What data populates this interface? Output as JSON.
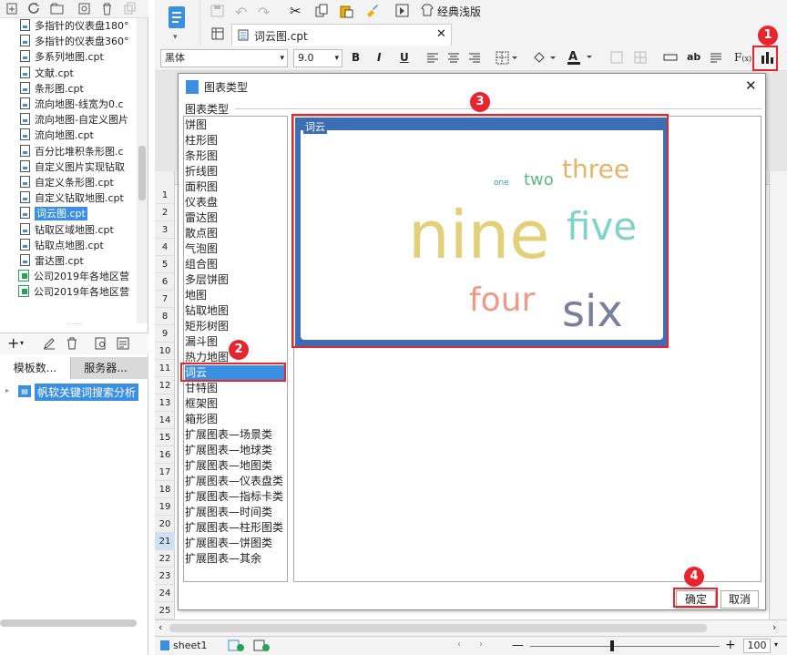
{
  "left_panel": {
    "tree_items": [
      {
        "label": "多指针的仪表盘180°",
        "type": "cpt"
      },
      {
        "label": "多指针的仪表盘360°",
        "type": "cpt"
      },
      {
        "label": "多系列地图.cpt",
        "type": "cpt"
      },
      {
        "label": "文献.cpt",
        "type": "cpt"
      },
      {
        "label": "条形图.cpt",
        "type": "cpt"
      },
      {
        "label": "流向地图-线宽为0.c",
        "type": "cpt"
      },
      {
        "label": "流向地图-自定义图片",
        "type": "cpt"
      },
      {
        "label": "流向地图.cpt",
        "type": "cpt"
      },
      {
        "label": "百分比堆积条形图.c",
        "type": "cpt"
      },
      {
        "label": "自定义图片实现钻取",
        "type": "cpt"
      },
      {
        "label": "自定义条形图.cpt",
        "type": "cpt"
      },
      {
        "label": "自定义钻取地图.cpt",
        "type": "cpt"
      },
      {
        "label": "词云图.cpt",
        "type": "cpt",
        "selected": true
      },
      {
        "label": "钻取区域地图.cpt",
        "type": "cpt"
      },
      {
        "label": "钻取点地图.cpt",
        "type": "cpt"
      },
      {
        "label": "雷达图.cpt",
        "type": "cpt"
      },
      {
        "label": "公司2019年各地区营",
        "type": "sheet"
      },
      {
        "label": "公司2019年各地区营",
        "type": "sheet"
      }
    ],
    "tabs": [
      "模板数...",
      "服务器..."
    ],
    "project_item": "帆软关键词搜索分析"
  },
  "toolbar": {
    "classic_style": "经典浅版",
    "file_tab": "词云图.cpt"
  },
  "format_bar": {
    "font": "黑体",
    "size": "9.0"
  },
  "row_numbers": [
    "1",
    "2",
    "3",
    "4",
    "5",
    "6",
    "7",
    "8",
    "9",
    "10",
    "11",
    "12",
    "13",
    "14",
    "15",
    "16",
    "17",
    "18",
    "19",
    "20",
    "21",
    "22",
    "23",
    "24",
    "25"
  ],
  "bottom": {
    "sheet_tab": "sheet1",
    "zoom": "100"
  },
  "dialog": {
    "title": "图表类型",
    "section_label": "图表类型",
    "types": [
      "饼图",
      "柱形图",
      "条形图",
      "折线图",
      "面积图",
      "仪表盘",
      "雷达图",
      "散点图",
      "气泡图",
      "组合图",
      "多层饼图",
      "地图",
      "钻取地图",
      "矩形树图",
      "漏斗图",
      "热力地图",
      "词云",
      "甘特图",
      "框架图",
      "箱形图",
      "扩展图表—场景类",
      "扩展图表—地球类",
      "扩展图表—地图类",
      "扩展图表—仪表盘类",
      "扩展图表—指标卡类",
      "扩展图表—时间类",
      "扩展图表—柱形图类",
      "扩展图表—饼图类",
      "扩展图表—其余"
    ],
    "selected_type": "词云",
    "preview_title": "词云",
    "words": [
      {
        "text": "one",
        "color": "#3a8fd0"
      },
      {
        "text": "two",
        "color": "#5fb88a"
      },
      {
        "text": "three",
        "color": "#e8b36a"
      },
      {
        "text": "nine",
        "color": "#e2d07a"
      },
      {
        "text": "five",
        "color": "#7fd3c8"
      },
      {
        "text": "four",
        "color": "#ef9a86"
      },
      {
        "text": "six",
        "color": "#7b7f9e"
      }
    ],
    "ok_label": "确定",
    "cancel_label": "取消"
  },
  "annotations": [
    "1",
    "2",
    "3",
    "4"
  ],
  "colors": {
    "highlight": "#e8242e",
    "selection": "#3b8fe0",
    "preview_frame": "#3b6eb5"
  }
}
